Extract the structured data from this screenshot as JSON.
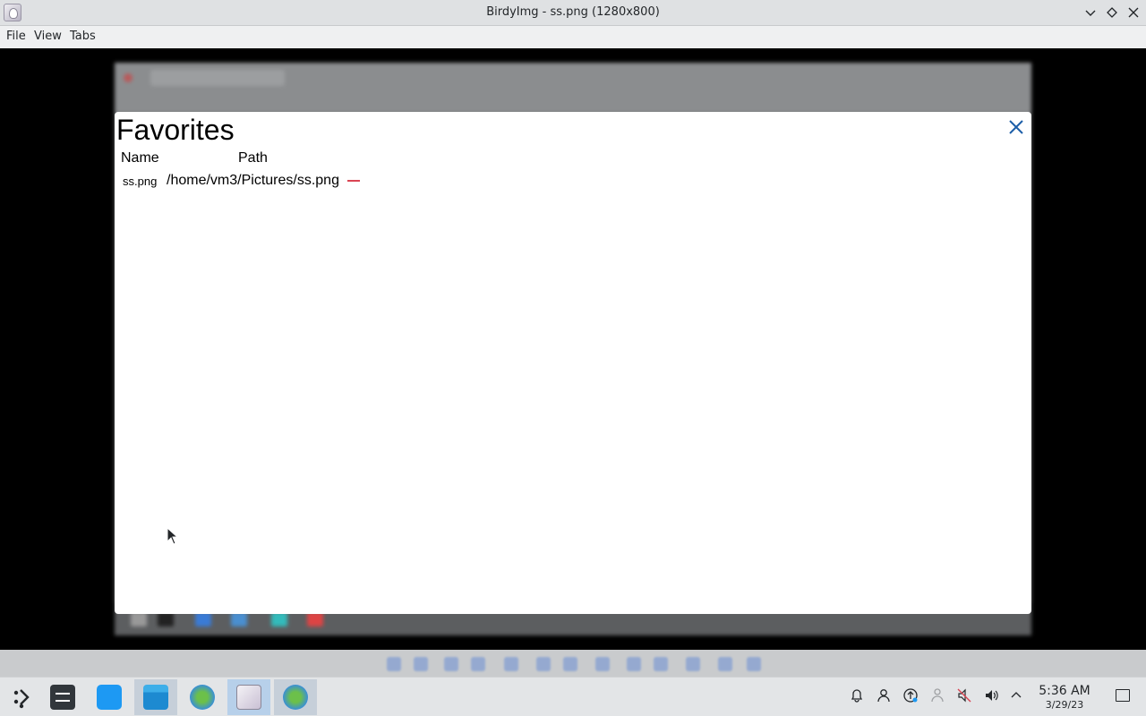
{
  "window": {
    "title": "BirdyImg - ss.png (1280x800)"
  },
  "menu": {
    "items": [
      "File",
      "View",
      "Tabs"
    ]
  },
  "dialog": {
    "title": "Favorites",
    "columns": {
      "name": "Name",
      "path": "Path"
    },
    "rows": [
      {
        "name": "ss.png",
        "path": "/home/vm3/Pictures/ss.png"
      }
    ]
  },
  "taskbar": {
    "tasks": [
      {
        "icon": "app-launcher-icon"
      },
      {
        "icon": "system-settings-icon"
      },
      {
        "icon": "discover-store-icon"
      },
      {
        "icon": "file-manager-icon"
      },
      {
        "icon": "browser-globe-icon"
      },
      {
        "icon": "birdyimg-icon"
      },
      {
        "icon": "browser-globe-icon"
      }
    ],
    "tray": [
      "notifications-icon",
      "user-icon",
      "updates-icon",
      "network-icon",
      "mute-icon",
      "volume-icon",
      "expand-tray-icon"
    ],
    "clock": {
      "time": "5:36 AM",
      "date": "3/29/23"
    }
  },
  "colors": {
    "accent": "#1d5fa8",
    "remove": "#da4453",
    "titlebar": "#dfe1e3",
    "taskbar": "#e3e5e7"
  }
}
